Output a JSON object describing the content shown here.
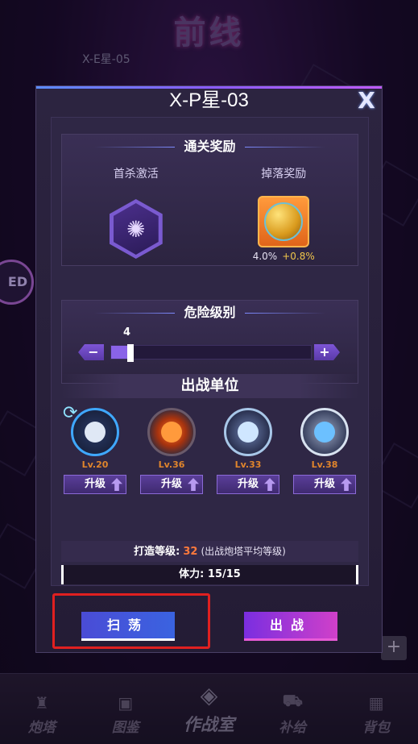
{
  "background": {
    "title": "前线",
    "node_label": "X-E星-05",
    "side_badge": "ED",
    "plus_label": "+"
  },
  "modal": {
    "title": "X-P星-03",
    "close_label": "X",
    "rewards": {
      "header": "通关奖励",
      "first_kill_label": "首杀激活",
      "drop_label": "掉落奖励",
      "drop_rate": "4.0%",
      "drop_bonus": "+0.8%"
    },
    "danger": {
      "header": "危险级别",
      "level": "4",
      "level_value": 4,
      "level_max": 50,
      "minus_label": "−",
      "plus_label": "+"
    },
    "units": {
      "header": "出战单位",
      "upgrade_label": "升级",
      "items": [
        {
          "level": "Lv.20",
          "color": "#3fa8ff"
        },
        {
          "level": "Lv.36",
          "color": "#ff6a1a"
        },
        {
          "level": "Lv.33",
          "color": "#a8c7e8"
        },
        {
          "level": "Lv.38",
          "color": "#d8e2f0"
        }
      ]
    },
    "craft": {
      "label": "打造等级:",
      "value": "32",
      "note": "(出战炮塔平均等级)"
    },
    "stamina": "体力: 15/15",
    "sweep_label": "扫荡",
    "battle_label": "出战"
  },
  "nav": {
    "items": [
      {
        "label": "炮塔",
        "icon": "turret-icon"
      },
      {
        "label": "图鉴",
        "icon": "codex-icon"
      },
      {
        "label": "作战室",
        "icon": "war-room-icon"
      },
      {
        "label": "补给",
        "icon": "cart-icon"
      },
      {
        "label": "背包",
        "icon": "backpack-icon"
      }
    ]
  }
}
